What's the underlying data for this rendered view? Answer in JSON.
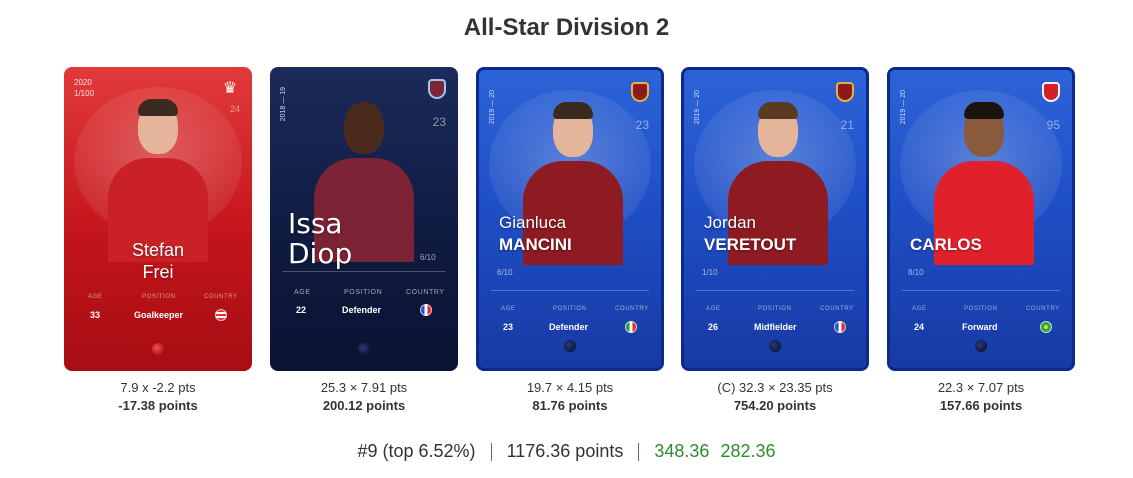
{
  "page": {
    "title": "All-Star Division 2"
  },
  "stat_labels": {
    "age": "AGE",
    "position": "POSITION",
    "country": "COUNTRY"
  },
  "cards": [
    {
      "style": "red",
      "edition": [
        "2020",
        "1/100"
      ],
      "club_icon": "crown-icon",
      "jersey_number": "24",
      "first_name": "Stefan",
      "last_name": "Frei",
      "age": "33",
      "position": "Goalkeeper",
      "country_icon": "us-flag-icon",
      "score_line": "7.9 x -2.2 pts",
      "total_points": "-17.38 points"
    },
    {
      "style": "navy",
      "season": "2018 — 19",
      "club_icon": "west-ham-crest-icon",
      "jersey_number": "23",
      "first_name": "Issa",
      "last_name": "Diop",
      "count": "6/10",
      "age": "22",
      "position": "Defender",
      "country_icon": "france-flag-icon",
      "score_line": "25.3 × 7.91 pts",
      "total_points": "200.12 points"
    },
    {
      "style": "blue",
      "season": "2019 — 20",
      "club_icon": "roma-crest-icon",
      "jersey_number": "23",
      "first_name": "Gianluca",
      "last_name": "MANCINI",
      "count": "6/10",
      "age": "23",
      "position": "Defender",
      "country_icon": "italy-flag-icon",
      "score_line": "19.7 × 4.15 pts",
      "total_points": "81.76 points"
    },
    {
      "style": "blue",
      "season": "2019 — 20",
      "club_icon": "roma-crest-icon",
      "jersey_number": "21",
      "first_name": "Jordan",
      "last_name": "VERETOUT",
      "count": "1/10",
      "age": "26",
      "position": "Midfielder",
      "country_icon": "france-flag-icon",
      "captain": "(C)",
      "score_line": "32.3 × 23.35 pts",
      "total_points": "754.20 points"
    },
    {
      "style": "blue",
      "season": "2019 — 20",
      "club_icon": "benfica-crest-icon",
      "jersey_number": "95",
      "first_name": "",
      "last_name": "CARLOS",
      "count": "8/10",
      "age": "24",
      "position": "Forward",
      "country_icon": "brazil-flag-icon",
      "score_line": "22.3 × 7.07 pts",
      "total_points": "157.66 points"
    }
  ],
  "summary": {
    "rank": "#9 (top 6.52%)",
    "points": "1176.36 points",
    "gap_1": "348.36",
    "gap_2": "282.36"
  },
  "colors": {
    "accent_green": "#2e8b2e",
    "red_card": "#c3151b",
    "blue_card": "#1f4fc6",
    "navy_card": "#0f1a3f"
  }
}
